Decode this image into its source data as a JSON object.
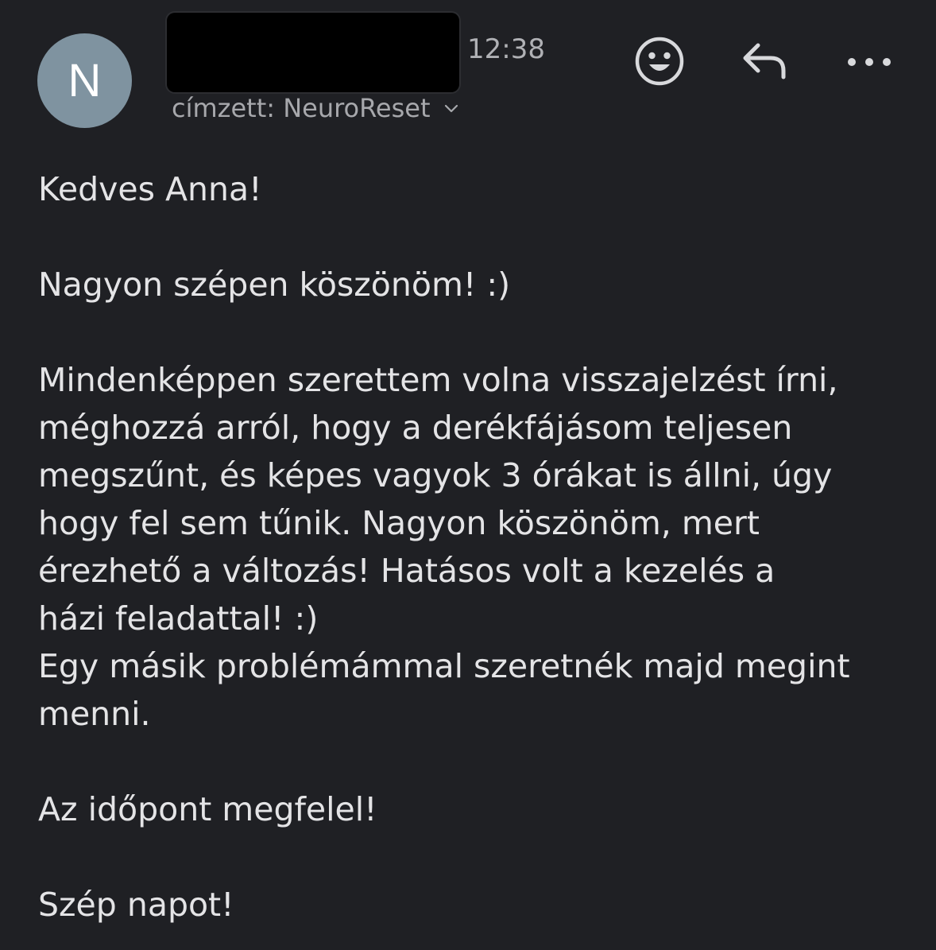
{
  "header": {
    "avatar_letter": "N",
    "time": "12:38",
    "recipient": "címzett: NeuroReset",
    "icons": {
      "emoji": "emoji-smile-icon",
      "reply": "reply-icon",
      "more": "more-dots-icon",
      "chevron": "chevron-down-icon"
    }
  },
  "message": {
    "greeting": "Kedves Anna!",
    "thanks": "Nagyon szépen köszönöm! :)",
    "paragraph_1_line_1": "Mindenképpen szerettem volna visszajelzést írni,",
    "paragraph_1_line_2": "méghozzá arról, hogy a derékfájásom teljesen",
    "paragraph_1_line_3": "megszűnt, és képes vagyok 3 órákat is állni, úgy",
    "paragraph_1_line_4": "hogy fel sem tűnik. Nagyon köszönöm, mert",
    "paragraph_1_line_5": "érezhető a változás! Hatásos volt a kezelés a",
    "paragraph_1_line_6": "házi feladattal! :)",
    "paragraph_2_line_1": "Egy másik problémámmal szeretnék majd megint",
    "paragraph_2_line_2": "menni.",
    "appointment": "Az időpont megfelel!",
    "closing": "Szép napot!"
  },
  "colors": {
    "background": "#1f2024",
    "avatar": "#7f93a0",
    "text": "#e4e4e6",
    "secondary_text": "#a7a8ac"
  }
}
